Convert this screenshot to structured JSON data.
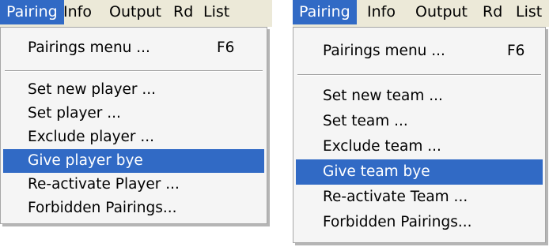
{
  "panels": [
    {
      "menubar": [
        "Pairing",
        "Info",
        "Output",
        "Rd",
        "List"
      ],
      "menu": {
        "pairings_menu": "Pairings menu ...",
        "pairings_shortcut": "F6",
        "items": [
          "Set new player ...",
          "Set player ...",
          "Exclude player ...",
          "Give player bye",
          "Re-activate Player ...",
          "Forbidden Pairings..."
        ]
      }
    },
    {
      "menubar": [
        "Pairing",
        "Info",
        "Output",
        "Rd",
        "List"
      ],
      "menu": {
        "pairings_menu": "Pairings menu ...",
        "pairings_shortcut": "F6",
        "items": [
          "Set new team ...",
          "Set team ...",
          "Exclude team ...",
          "Give team bye",
          "Re-activate Team ...",
          "Forbidden Pairings..."
        ]
      }
    }
  ],
  "colors": {
    "highlight": "#316ac5",
    "menubar_bg": "#ece9d8",
    "menu_bg": "#f5f5f5"
  }
}
